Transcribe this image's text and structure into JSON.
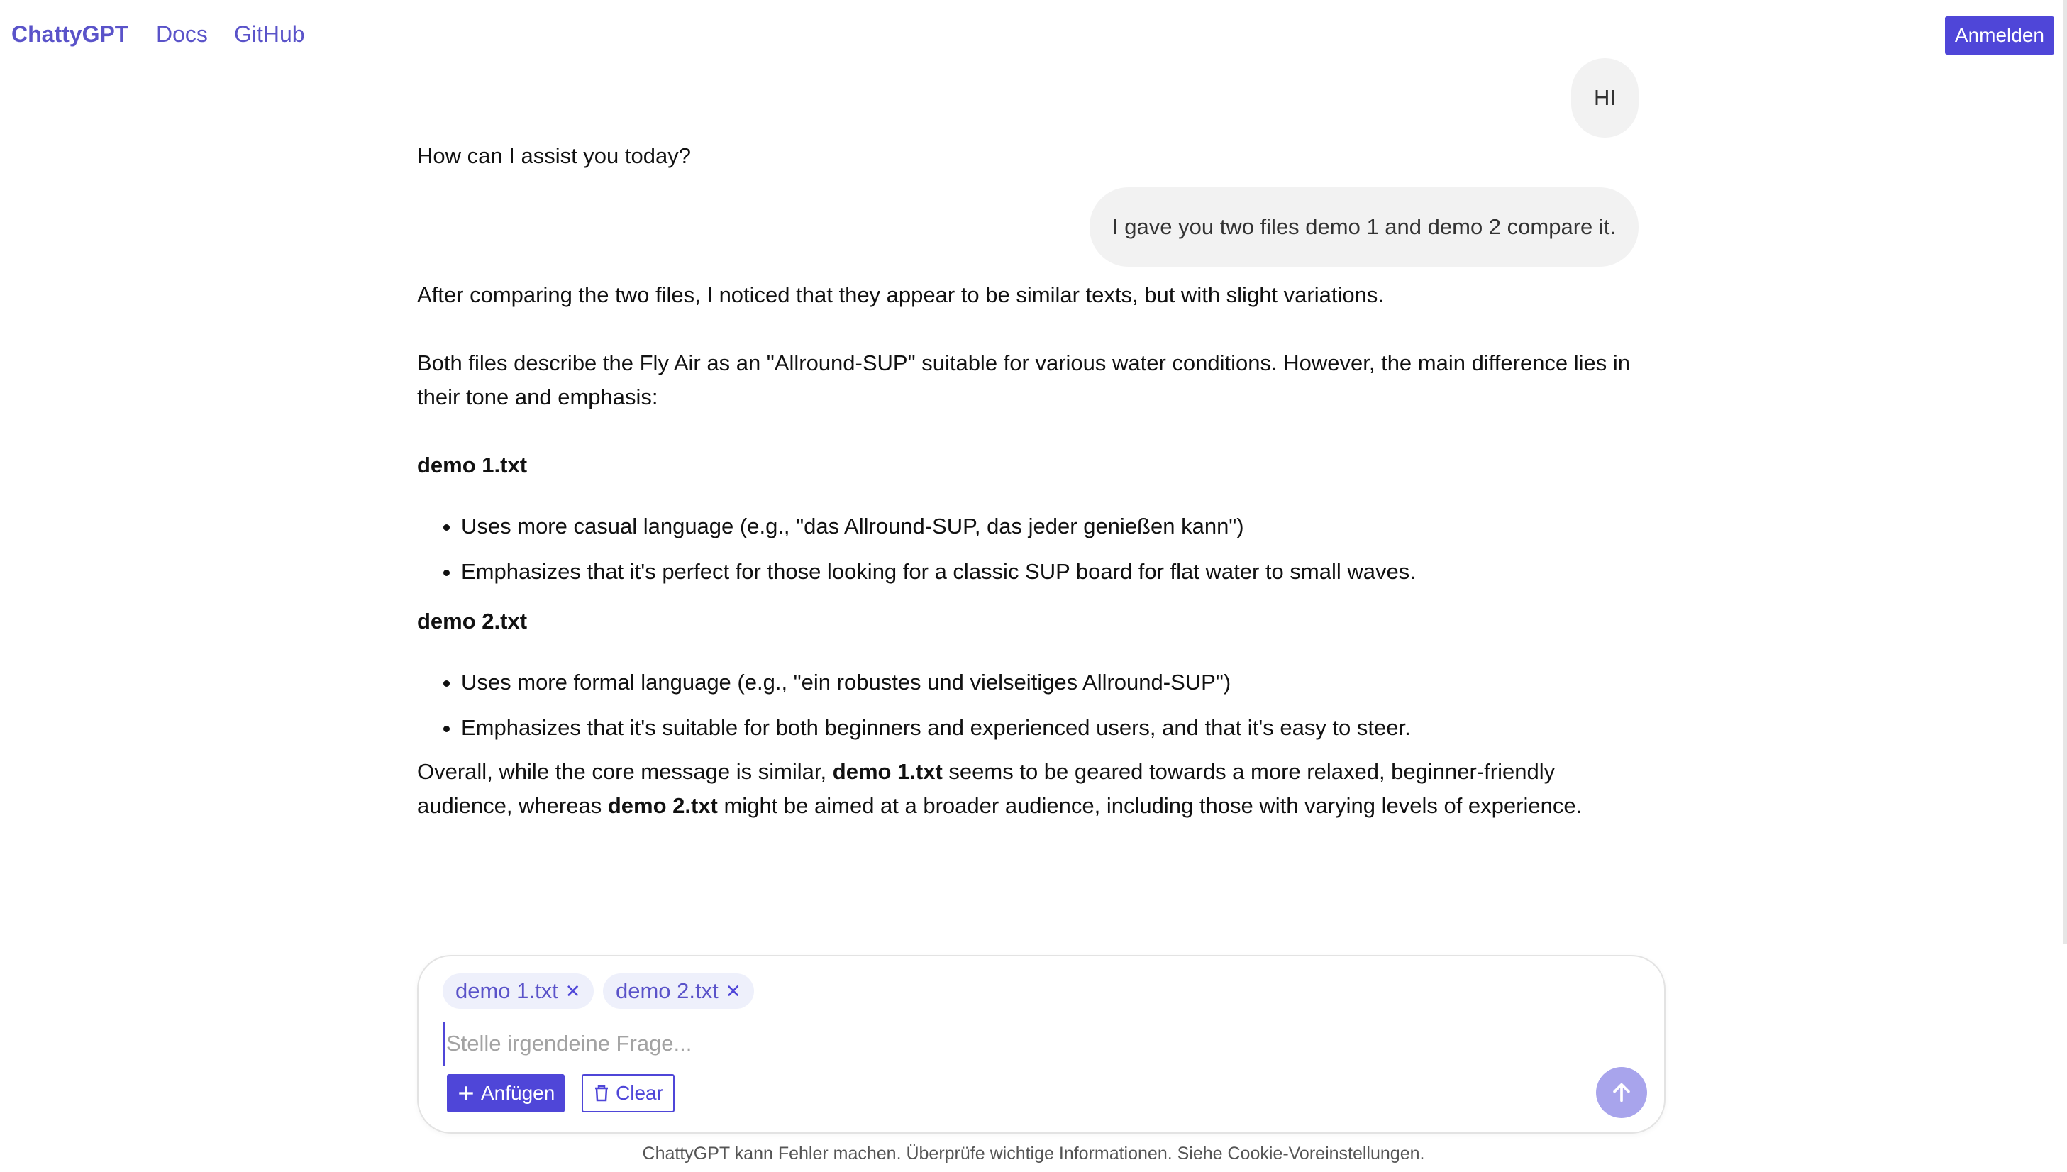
{
  "nav": {
    "brand": "ChattyGPT",
    "links": [
      "Docs",
      "GitHub"
    ],
    "login": "Anmelden"
  },
  "messages": {
    "m1_user": "HI",
    "m2_assistant": "How can I assist you today?",
    "m3_user": "I gave you two files demo 1 and demo 2 compare it.",
    "m4": {
      "p1": "After comparing the two files, I noticed that they appear to be similar texts, but with slight variations.",
      "p2": "Both files describe the Fly Air as an \"Allround-SUP\" suitable for various water conditions. However, the main difference lies in their tone and emphasis:",
      "h1": "demo 1.txt",
      "l1": [
        "Uses more casual language (e.g., \"das Allround-SUP, das jeder genießen kann\")",
        "Emphasizes that it's perfect for those looking for a classic SUP board for flat water to small waves."
      ],
      "h2": "demo 2.txt",
      "l2": [
        "Uses more formal language (e.g., \"ein robustes und vielseitiges Allround-SUP\")",
        "Emphasizes that it's suitable for both beginners and experienced users, and that it's easy to steer."
      ],
      "conclusion": {
        "t1": "Overall, while the core message is similar, ",
        "b1": "demo 1.txt",
        "t2": " seems to be geared towards a more relaxed, beginner-friendly audience, whereas ",
        "b2": "demo 2.txt",
        "t3": " might be aimed at a broader audience, including those with varying levels of experience."
      }
    }
  },
  "composer": {
    "chips": [
      "demo 1.txt",
      "demo 2.txt"
    ],
    "placeholder": "Stelle irgendeine Frage...",
    "attach_label": "Anfügen",
    "clear_label": "Clear"
  },
  "footer": "ChattyGPT kann Fehler machen. Überprüfe wichtige Informationen. Siehe Cookie-Voreinstellungen.",
  "colors": {
    "accent": "#4f46d8",
    "brand": "#5a53c9",
    "bubble": "#f2f2f2",
    "send_disabled": "#a8a4ec"
  },
  "icons": [
    "plus-icon",
    "trash-icon",
    "arrow-up-icon",
    "close-icon"
  ]
}
